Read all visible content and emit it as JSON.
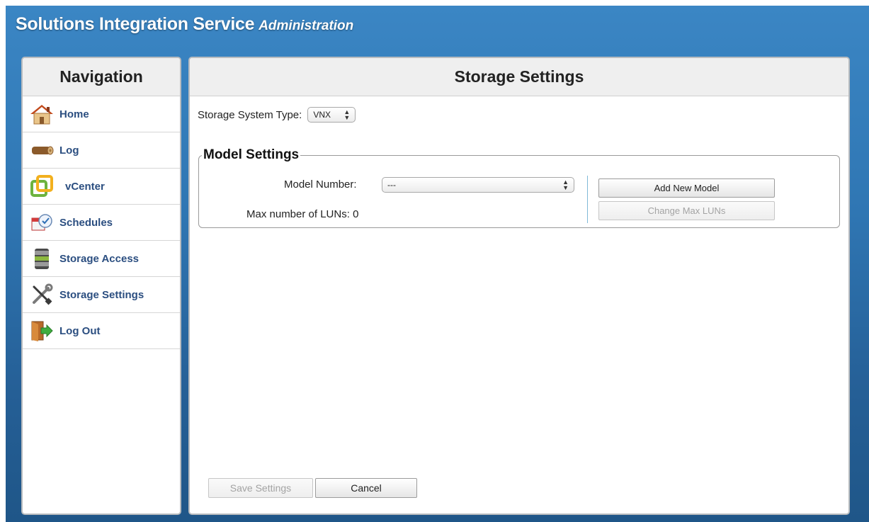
{
  "app": {
    "title": "Solutions Integration Service",
    "subtitle": "Administration"
  },
  "nav": {
    "title": "Navigation",
    "items": [
      {
        "label": "Home",
        "icon": "home-icon"
      },
      {
        "label": "Log",
        "icon": "log-icon"
      },
      {
        "label": "vCenter",
        "icon": "vcenter-icon"
      },
      {
        "label": "Schedules",
        "icon": "calendar-icon"
      },
      {
        "label": "Storage Access",
        "icon": "storage-icon"
      },
      {
        "label": "Storage Settings",
        "icon": "tools-icon"
      },
      {
        "label": "Log Out",
        "icon": "logout-icon"
      }
    ]
  },
  "main": {
    "title": "Storage Settings",
    "system_type_label": "Storage System Type:",
    "system_type_value": "VNX",
    "model_settings": {
      "legend": "Model Settings",
      "model_number_label": "Model Number:",
      "model_number_value": "---",
      "max_luns_label": "Max number of LUNs:",
      "max_luns_value": "0",
      "add_button": "Add New Model",
      "change_button": "Change Max LUNs"
    },
    "save_button": "Save Settings",
    "cancel_button": "Cancel"
  },
  "colors": {
    "accent_blue": "#2f76b3",
    "nav_label": "#2b4e80"
  }
}
